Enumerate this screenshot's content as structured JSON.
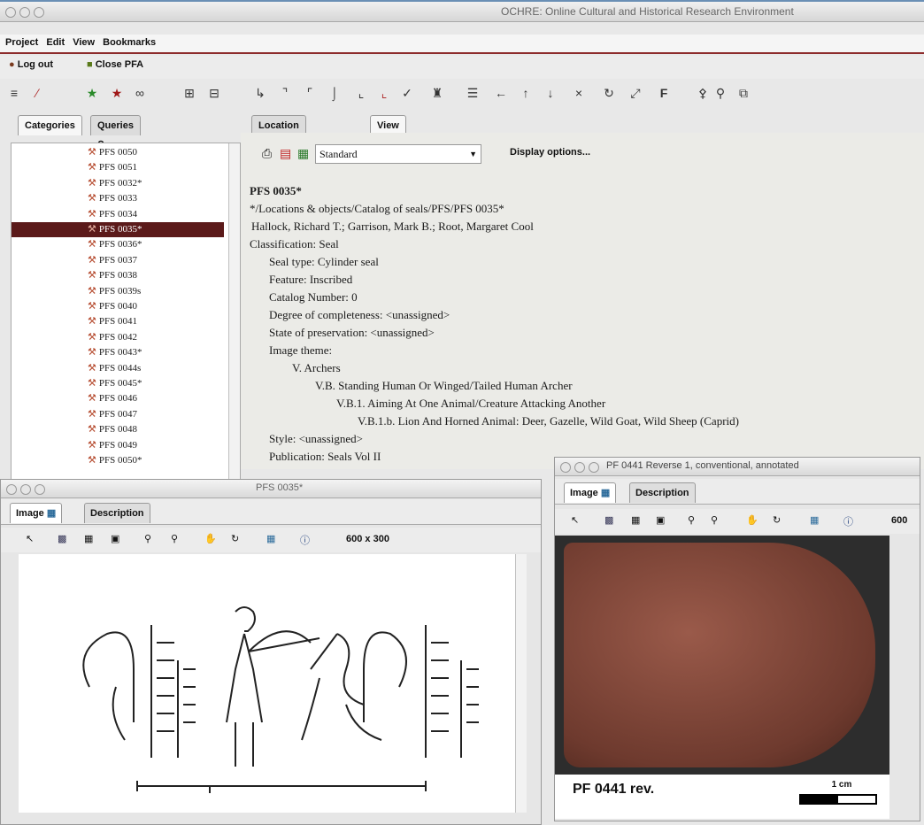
{
  "window": {
    "title": "OCHRE: Online Cultural and Historical Research Environment"
  },
  "menubar": {
    "items": [
      "Project",
      "Edit",
      "View",
      "Bookmarks"
    ]
  },
  "toolbar": {
    "logout_label": "Log out",
    "close_label": "Close PFA"
  },
  "left_panel": {
    "tabs": [
      "Categories",
      "Queries"
    ],
    "items": [
      "PFS 0050",
      "PFS 0051",
      "PFS 0032*",
      "PFS 0033",
      "PFS 0034",
      "PFS 0035*",
      "PFS 0036*",
      "PFS 0037",
      "PFS 0038",
      "PFS 0039s",
      "PFS 0040",
      "PFS 0041",
      "PFS 0042",
      "PFS 0043*",
      "PFS 0044s",
      "PFS 0045*",
      "PFS 0046",
      "PFS 0047",
      "PFS 0048",
      "PFS 0049",
      "PFS 0050*"
    ],
    "selected_index": 5
  },
  "main": {
    "tabs": [
      "Location or object",
      "View"
    ],
    "view_select": "Standard",
    "display_options": "Display options...",
    "lines": [
      "PFS 0035*",
      "*/Locations & objects/Catalog of seals/PFS/PFS 0035*",
      "Hallock, Richard T.; Garrison, Mark B.; Root, Margaret Cool",
      "Classification:  Seal",
      "Seal type:  Cylinder seal",
      "Feature:  Inscribed",
      "Catalog Number:  0",
      "Degree of completeness:  <unassigned>",
      "State of preservation:  <unassigned>",
      "Image theme:",
      "V. Archers",
      "V.B. Standing Human Or Winged/Tailed Human Archer",
      "V.B.1. Aiming At One Animal/Creature Attacking Another",
      "V.B.1.b. Lion And Horned Animal: Deer, Gazelle, Wild Goat, Wild Sheep (Caprid)",
      "Style:  <unassigned>",
      "Publication:  Seals Vol II"
    ]
  },
  "seal_window": {
    "title": "PFS 0035*",
    "tabs": [
      "Image",
      "Description"
    ],
    "size_label": "600 x 300"
  },
  "tablet_window": {
    "title": "PF 0441 Reverse 1, conventional, annotated",
    "tabs": [
      "Image",
      "Description"
    ],
    "size_label": "600",
    "caption": "PF 0441 rev.",
    "scale_label": "1 cm"
  }
}
